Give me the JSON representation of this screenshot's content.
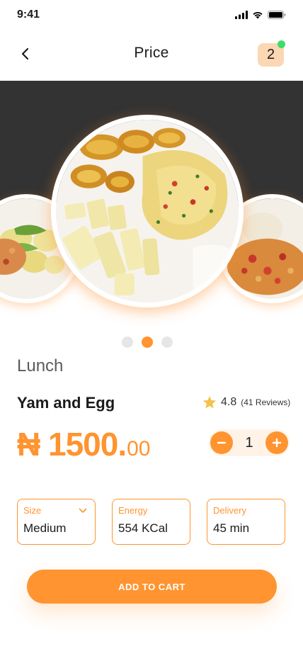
{
  "status": {
    "time": "9:41"
  },
  "header": {
    "title": "Price",
    "cart_count": "2"
  },
  "carousel": {
    "page_count": 3,
    "active_index": 1
  },
  "product": {
    "category": "Lunch",
    "name": "Yam and Egg",
    "rating": "4.8",
    "reviews": "(41 Reviews)",
    "price_main": "₦ 1500.",
    "price_cents": "00",
    "quantity": "1"
  },
  "info": {
    "size": {
      "label": "Size",
      "value": "Medium"
    },
    "energy": {
      "label": "Energy",
      "value": "554 KCal"
    },
    "delivery": {
      "label": "Delivery",
      "value": "45 min"
    }
  },
  "cta": {
    "label": "ADD TO CART"
  },
  "colors": {
    "accent": "#ff9430",
    "badge_bg": "#fcd7b4",
    "online_dot": "#3fdc6a",
    "hero_dark": "#333333"
  },
  "icons": [
    "signal-icon",
    "wifi-icon",
    "battery-icon",
    "back-arrow-icon",
    "star-icon",
    "minus-icon",
    "plus-icon",
    "chevron-down-icon"
  ]
}
